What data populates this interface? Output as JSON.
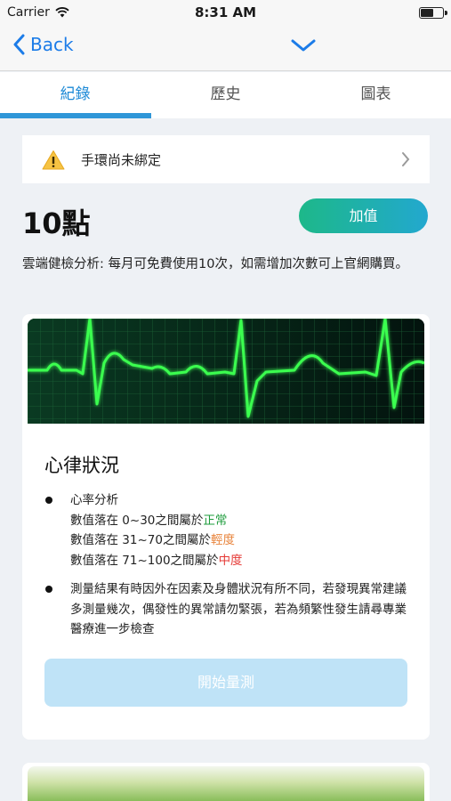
{
  "status_bar": {
    "carrier": "Carrier",
    "time": "8:31 AM",
    "battery_level": 0.55
  },
  "nav": {
    "back_label": "Back",
    "back_icon": "chevron-left-icon",
    "collapse_icon": "chevron-down-icon"
  },
  "tabs": [
    {
      "label": "紀錄",
      "active": true
    },
    {
      "label": "歷史",
      "active": false
    },
    {
      "label": "圖表",
      "active": false
    }
  ],
  "band_notice": {
    "text": "手環尚未綁定",
    "icon": "warning-icon"
  },
  "points": {
    "value": "10點"
  },
  "topup": {
    "label": "加值"
  },
  "info": {
    "text": "雲端健檢分析: 每月可免費使用10次，如需增加次數可上官網購買。"
  },
  "heart_card": {
    "title": "心律狀況",
    "analysis_title": "心率分析",
    "ranges": [
      {
        "prefix": "數值落在 0~30之間屬於",
        "level": "正常"
      },
      {
        "prefix": "數值落在 31~70之間屬於",
        "level": "輕度"
      },
      {
        "prefix": "數值落在 71~100之間屬於",
        "level": "中度"
      }
    ],
    "note": "測量結果有時因外在因素及身體狀況有所不同，若發現異常建議多測量幾次，偶發性的異常請勿緊張，若為頻繁性發生請尋專業醫療進一步檢查",
    "start_label": "開始量測"
  },
  "colors": {
    "accent": "#1c89d6",
    "normal": "#1e9c3c",
    "mild": "#e8843c",
    "moderate": "#e53935",
    "topup_from": "#1db889",
    "topup_to": "#22a8cf"
  }
}
